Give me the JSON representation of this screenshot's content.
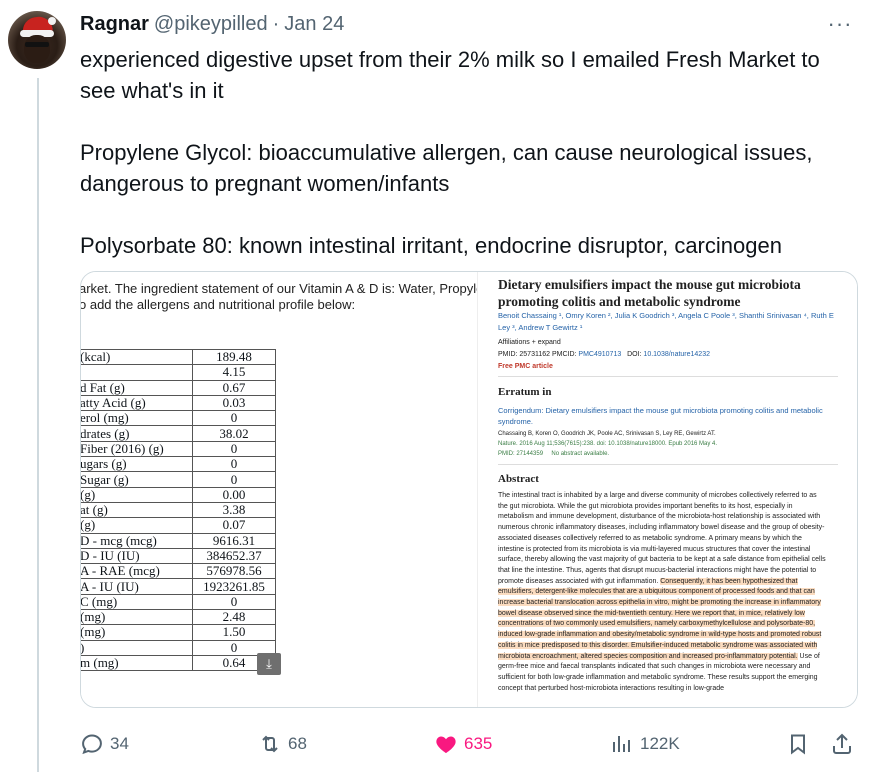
{
  "author": {
    "name": "Ragnar",
    "handle": "@pikeypilled",
    "separator": "·",
    "date": "Jan 24"
  },
  "more_label": "···",
  "tweet_lines": [
    "experienced digestive upset from their 2% milk so I emailed Fresh Market to",
    "see what's in it",
    "",
    "Propylene Glycol: bioaccumulative allergen, can cause neurological issues,",
    "dangerous to pregnant women/infants",
    "",
    "Polysorbate 80: known intestinal irritant, endocrine disruptor, carcinogen"
  ],
  "image_left": {
    "line1": "arket. The ingredient statement of our Vitamin A & D is: Water, Propyle",
    "line2": "o add the allergens and nutritional profile below:",
    "rows": [
      {
        "name": "(kcal)",
        "value": "189.48"
      },
      {
        "name": "",
        "value": "4.15"
      },
      {
        "name": "d Fat (g)",
        "value": "0.67"
      },
      {
        "name": "atty Acid (g)",
        "value": "0.03"
      },
      {
        "name": "erol (mg)",
        "value": "0"
      },
      {
        "name": "drates (g)",
        "value": "38.02"
      },
      {
        "name": "Fiber (2016) (g)",
        "value": "0"
      },
      {
        "name": "ugars (g)",
        "value": "0"
      },
      {
        "name": "Sugar (g)",
        "value": "0"
      },
      {
        "name": "(g)",
        "value": "0.00"
      },
      {
        "name": "at (g)",
        "value": "3.38"
      },
      {
        "name": "(g)",
        "value": "0.07"
      },
      {
        "name": "D - mcg (mcg)",
        "value": "9616.31"
      },
      {
        "name": "D - IU (IU)",
        "value": "384652.37"
      },
      {
        "name": "A - RAE (mcg)",
        "value": "576978.56"
      },
      {
        "name": "A - IU (IU)",
        "value": "1923261.85"
      },
      {
        "name": "C (mg)",
        "value": "0"
      },
      {
        "name": "(mg)",
        "value": "2.48"
      },
      {
        "name": "(mg)",
        "value": "1.50"
      },
      {
        "name": ")",
        "value": "0"
      },
      {
        "name": "m (mg)",
        "value": "0.64"
      }
    ]
  },
  "image_right": {
    "title": "Dietary emulsifiers impact the mouse gut microbiota promoting colitis and metabolic syndrome",
    "authors": "Benoit Chassaing ¹, Omry Koren ², Julia K Goodrich ³, Angela C Poole ³, Shanthi Srinivasan ⁴, Ruth E Ley ³, Andrew T Gewirtz ¹",
    "affiliations": "Affiliations  + expand",
    "pmid_label": "PMID: 25731162   PMCID:",
    "pmcid": "PMC4910713",
    "doi_label": "DOI:",
    "doi": "10.1038/nature14232",
    "free": "Free PMC article",
    "erratum_heading": "Erratum in",
    "erratum_link": "Corrigendum: Dietary emulsifiers impact the mouse gut microbiota promoting colitis and metabolic syndrome.",
    "erratum_authors": "Chassaing B, Koren O, Goodrich JK, Poole AC, Srinivasan S, Ley RE, Gewirtz AT.",
    "erratum_cite": "Nature. 2016 Aug 11;536(7615):238. doi: 10.1038/nature18000. Epub 2016 May 4.",
    "erratum_pmid": "PMID: 27144359",
    "erratum_noabs": "No abstract available.",
    "abstract_heading": "Abstract",
    "abstract_plain": "The intestinal tract is inhabited by a large and diverse community of microbes collectively referred to as the gut microbiota. While the gut microbiota provides important benefits to its host, especially in metabolism and immune development, disturbance of the microbiota-host relationship is associated with numerous chronic inflammatory diseases, including inflammatory bowel disease and the group of obesity-associated diseases collectively referred to as metabolic syndrome. A primary means by which the intestine is protected from its microbiota is via multi-layered mucus structures that cover the intestinal surface, thereby allowing the vast majority of gut bacteria to be kept at a safe distance from epithelial cells that line the intestine. Thus, agents that disrupt mucus-bacterial interactions might have the potential to promote diseases associated with gut inflammation. ",
    "abstract_highlight": "Consequently, it has been hypothesized that emulsifiers, detergent-like molecules that are a ubiquitous component of processed foods and that can increase bacterial translocation across epithelia in vitro, might be promoting the increase in inflammatory bowel disease observed since the mid-twentieth century. Here we report that, in mice, relatively low concentrations of two commonly used emulsifiers, namely carboxymethylcellulose and polysorbate-80, induced low-grade inflammation and obesity/metabolic syndrome in wild-type hosts and promoted robust colitis in mice predisposed to this disorder. Emulsifier-induced metabolic syndrome was associated with microbiota encroachment, altered species composition and increased pro-inflammatory potential.",
    "abstract_tail": " Use of germ-free mice and faecal transplants indicated that such changes in microbiota were necessary and sufficient for both low-grade inflammation and metabolic syndrome. These results support the emerging concept that perturbed host-microbiota interactions resulting in low-grade"
  },
  "actions": {
    "replies": "34",
    "reposts": "68",
    "likes": "635",
    "views": "122K"
  },
  "colors": {
    "like": "#f91880",
    "muted": "#536471",
    "link": "#2563a8",
    "highlight": "#fbdcc0"
  }
}
